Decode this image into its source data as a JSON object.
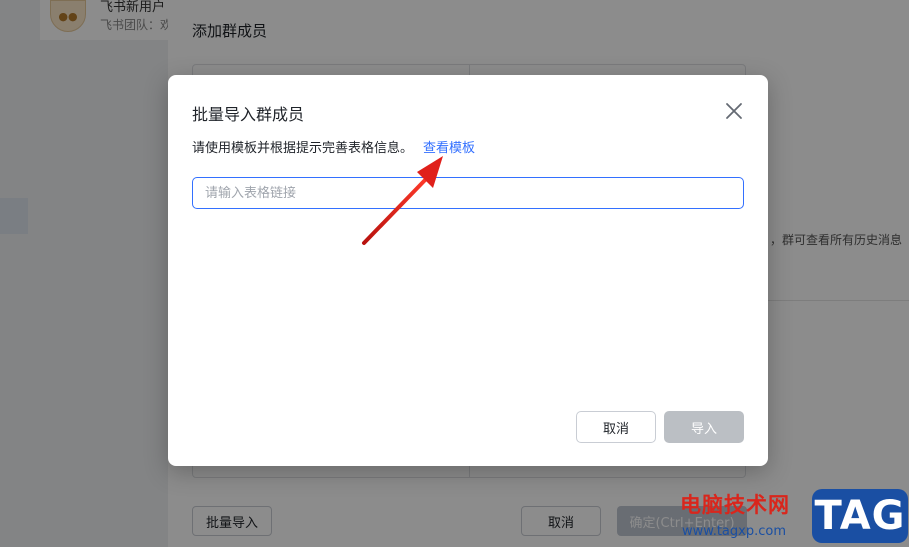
{
  "background": {
    "chat": {
      "title": "飞书新用户",
      "subtitle": "飞书团队：欢"
    },
    "panel": {
      "title": "添加群成员",
      "batch_import_label": "批量导入",
      "cancel_label": "取消",
      "confirm_label": "确定(Ctrl+Enter)"
    },
    "right_hint": "，群可查看所有历史消息"
  },
  "modal": {
    "title": "批量导入群成员",
    "description": "请使用模板并根据提示完善表格信息。",
    "template_link": "查看模板",
    "input_placeholder": "请输入表格链接",
    "input_value": "",
    "cancel_label": "取消",
    "import_label": "导入",
    "close_icon": "close-icon"
  },
  "annotation": {
    "arrow_color": "#e0201b"
  },
  "watermark": {
    "site_name": "电脑技术网",
    "url": "www.tagxp.com",
    "logo": "TAG"
  },
  "colors": {
    "accent": "#3370ff",
    "disabled_button": "#bbbfc4"
  }
}
